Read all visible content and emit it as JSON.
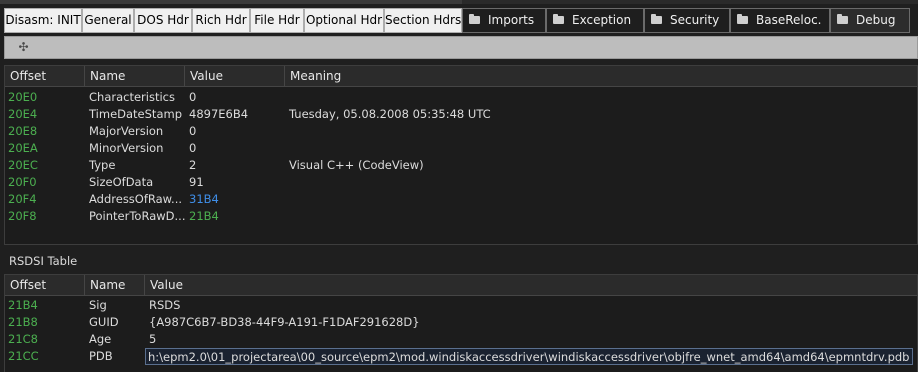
{
  "tabs": [
    {
      "label": "Disasm: INIT",
      "folder": false
    },
    {
      "label": "General",
      "folder": false
    },
    {
      "label": "DOS Hdr",
      "folder": false
    },
    {
      "label": "Rich Hdr",
      "folder": false
    },
    {
      "label": "File Hdr",
      "folder": false
    },
    {
      "label": "Optional Hdr",
      "folder": false
    },
    {
      "label": "Section Hdrs",
      "folder": false
    },
    {
      "label": "Imports",
      "folder": true
    },
    {
      "label": "Exception",
      "folder": true
    },
    {
      "label": "Security",
      "folder": true
    },
    {
      "label": "BaseReloc.",
      "folder": true
    },
    {
      "label": "Debug",
      "folder": true
    }
  ],
  "toolbar": {
    "move_icon": "move-icon"
  },
  "debug_table": {
    "columns": [
      "Offset",
      "Name",
      "Value",
      "Meaning"
    ],
    "rows": [
      {
        "offset": "20E0",
        "name": "Characteristics",
        "value": "0",
        "meaning": ""
      },
      {
        "offset": "20E4",
        "name": "TimeDateStamp",
        "value": "4897E6B4",
        "meaning": "Tuesday, 05.08.2008 05:35:48 UTC"
      },
      {
        "offset": "20E8",
        "name": "MajorVersion",
        "value": "0",
        "meaning": ""
      },
      {
        "offset": "20EA",
        "name": "MinorVersion",
        "value": "0",
        "meaning": ""
      },
      {
        "offset": "20EC",
        "name": "Type",
        "value": "2",
        "meaning": "Visual C++ (CodeView)"
      },
      {
        "offset": "20F0",
        "name": "SizeOfData",
        "value": "91",
        "meaning": ""
      },
      {
        "offset": "20F4",
        "name": "AddressOfRaw...",
        "value": "31B4",
        "meaning": ""
      },
      {
        "offset": "20F8",
        "name": "PointerToRawD...",
        "value": "21B4",
        "meaning": ""
      }
    ]
  },
  "rsdsi": {
    "title": "RSDSI Table",
    "columns": [
      "Offset",
      "Name",
      "Value"
    ],
    "rows": [
      {
        "offset": "21B4",
        "name": "Sig",
        "value": "RSDS"
      },
      {
        "offset": "21B8",
        "name": "GUID",
        "value": "{A987C6B7-BD38-44F9-A191-F1DAF291628D}"
      },
      {
        "offset": "21C8",
        "name": "Age",
        "value": "5"
      },
      {
        "offset": "21CC",
        "name": "PDB",
        "value": "h:\\epm2.0\\01_projectarea\\00_source\\epm2\\mod.windiskaccessdriver\\windiskaccessdriver\\objfre_wnet_amd64\\amd64\\epmntdrv.pdb"
      }
    ]
  },
  "colors": {
    "offset": "#4caf50",
    "link_blue": "#3f8ee8",
    "link_green": "#4caf50"
  }
}
